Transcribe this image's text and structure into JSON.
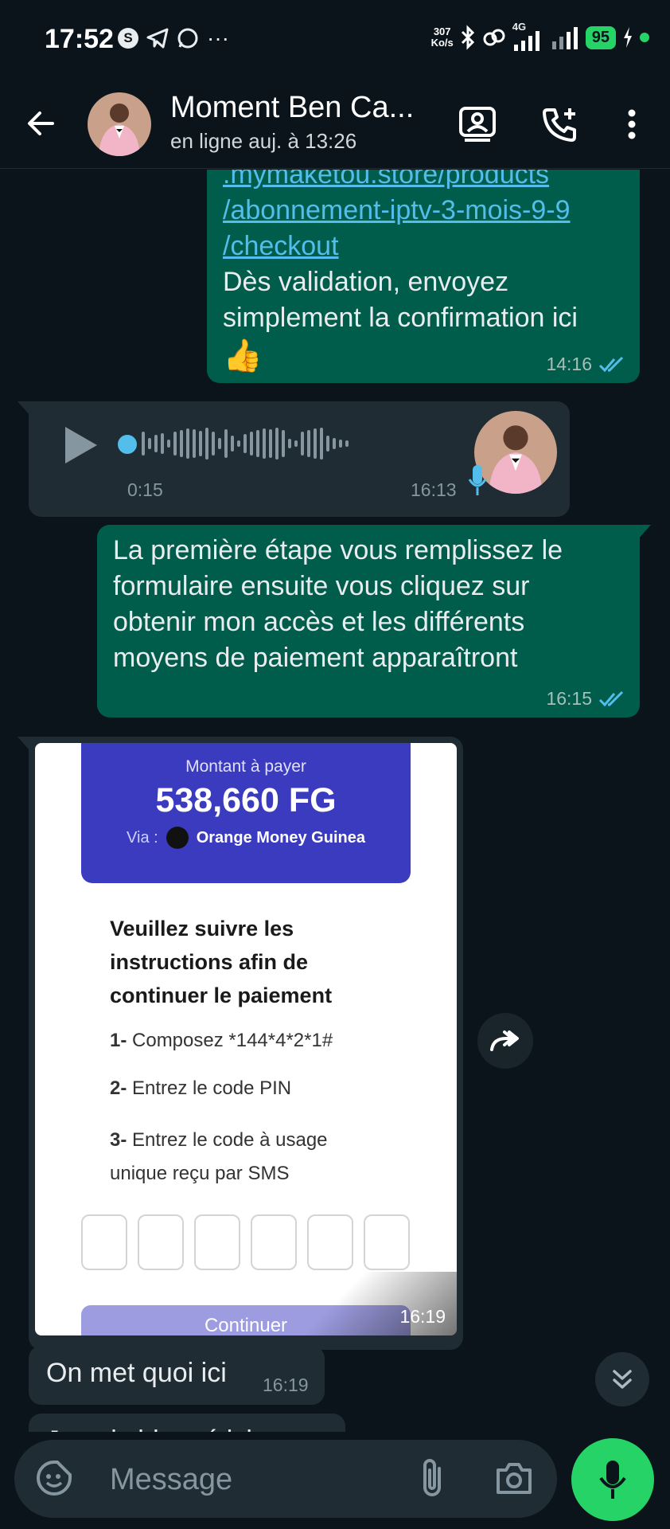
{
  "status_bar": {
    "time": "17:52",
    "speed_value": "307",
    "speed_unit": "Ko/s",
    "network": "4G",
    "battery": "95",
    "icons": [
      "s-circle-icon",
      "telegram-icon",
      "whatsapp-icon",
      "more-dots-icon",
      "bluetooth-icon",
      "link-icon",
      "signal-icon",
      "signal-icon",
      "charging-icon"
    ]
  },
  "header": {
    "contact_name": "Moment Ben Ca...",
    "contact_status": "en ligne auj. à 13:26",
    "icons": [
      "back-arrow-icon",
      "contact-card-icon",
      "add-call-icon",
      "more-vert-icon"
    ]
  },
  "messages": {
    "m1": {
      "link_line0": ".mymaketou.store/products",
      "link_line1": "/abonnement-iptv-3-mois-9-9",
      "link_line2": "/checkout",
      "text": "Dès validation, envoyez simplement la confirmation ici",
      "emoji": "👍",
      "time": "14:16"
    },
    "m2": {
      "duration": "0:15",
      "time": "16:13"
    },
    "m3": {
      "text": "La première étape vous remplissez le formulaire ensuite vous cliquez sur obtenir mon accès et les différents moyens de paiement apparaîtront",
      "time": "16:15"
    },
    "m4": {
      "time": "16:19",
      "image": {
        "amount_label": "Montant à payer",
        "amount": "538,660 FG",
        "via_label": "Via :",
        "provider": "Orange Money Guinea",
        "instructions_title": "Veuillez suivre les instructions afin de continuer le paiement",
        "step1_num": "1-",
        "step1": " Composez *144*4*2*1#",
        "step2_num": "2-",
        "step2": " Entrez le code PIN",
        "step3_num": "3-",
        "step3": " Entrez le code à usage unique reçu par SMS",
        "button": "Continuer"
      }
    },
    "m5": {
      "text": "On met quoi ici",
      "time": "16:19"
    },
    "m6": {
      "text": "Je suis bloqué ici"
    }
  },
  "input": {
    "placeholder": "Message",
    "icons": [
      "sticker-icon",
      "attach-icon",
      "camera-icon",
      "mic-icon"
    ]
  },
  "colors": {
    "background": "#0b141a",
    "outgoing_bubble": "#005c4b",
    "incoming_bubble": "#202c33",
    "accent": "#25d366",
    "link": "#53bdeb",
    "payment_header": "#3b3bbf"
  }
}
